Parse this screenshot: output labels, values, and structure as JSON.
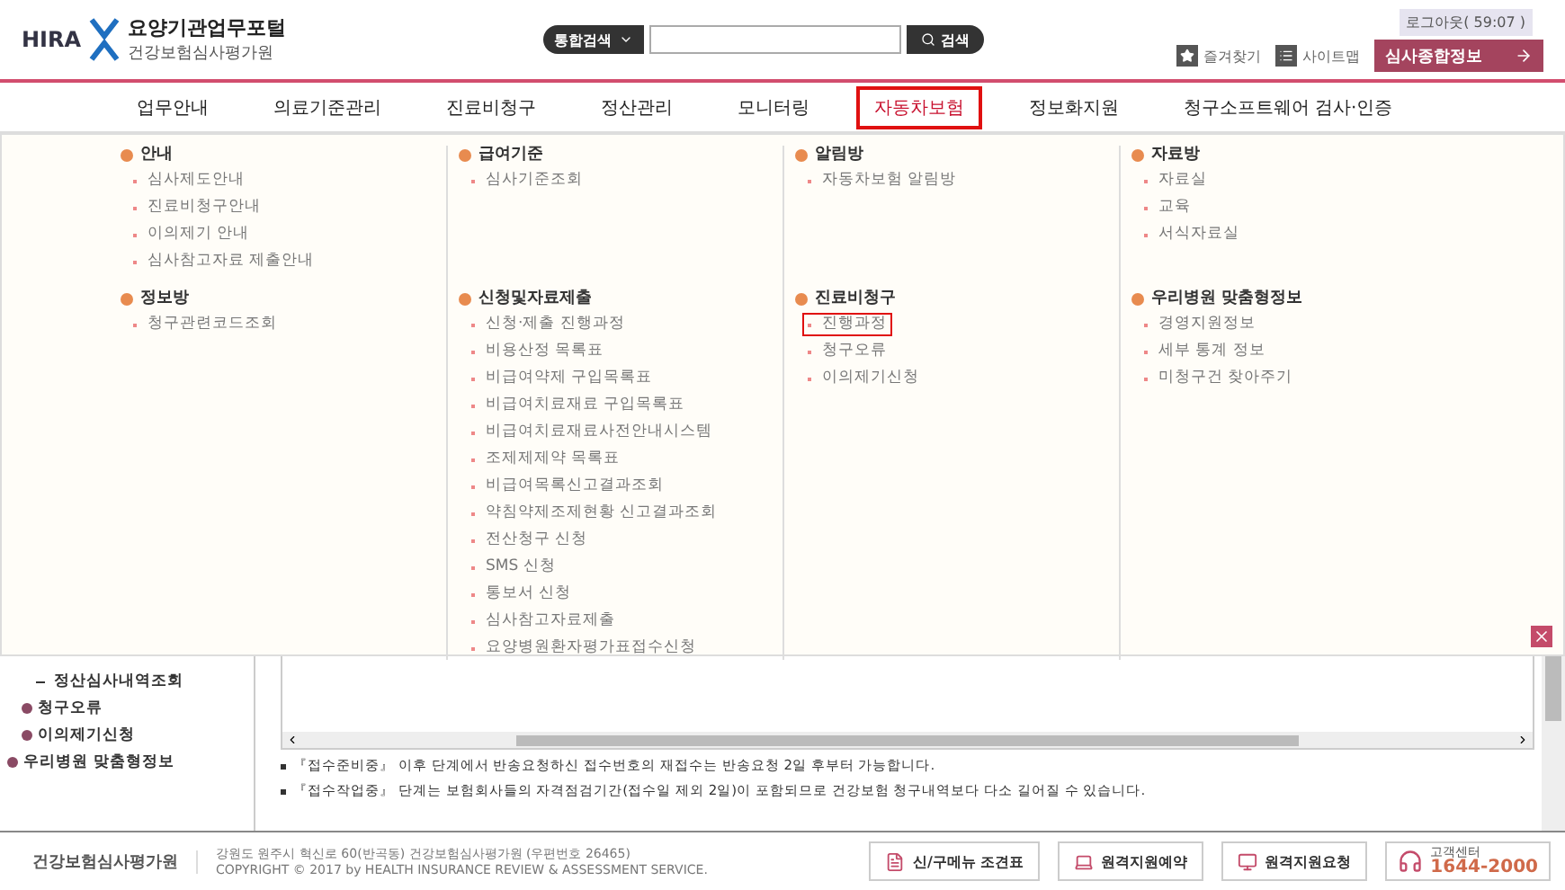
{
  "header": {
    "logo_brand": "HIRA",
    "logo_title": "요양기관업무포털",
    "logo_subtitle": "건강보험심사평가원",
    "search_scope": "통합검색",
    "search_button": "검색",
    "logout": "로그아웃( 59:07 )",
    "favorites": "즐겨찾기",
    "sitemap": "사이트맵",
    "review_info_button": "심사종합정보"
  },
  "nav": [
    {
      "label": "업무안내",
      "selected": false
    },
    {
      "label": "의료기준관리",
      "selected": false
    },
    {
      "label": "진료비청구",
      "selected": false
    },
    {
      "label": "정산관리",
      "selected": false
    },
    {
      "label": "모니터링",
      "selected": false
    },
    {
      "label": "자동차보험",
      "selected": true
    },
    {
      "label": "정보화지원",
      "selected": false
    },
    {
      "label": "청구소프트웨어 검사·인증",
      "selected": false
    }
  ],
  "mega_menu": {
    "columns": [
      {
        "groups": [
          {
            "title": "안내",
            "items": [
              {
                "label": "심사제도안내",
                "selected": false
              },
              {
                "label": "진료비청구안내",
                "selected": false
              },
              {
                "label": "이의제기 안내",
                "selected": false
              },
              {
                "label": "심사참고자료 제출안내",
                "selected": false
              }
            ]
          },
          {
            "title": "정보방",
            "items": [
              {
                "label": "청구관련코드조회",
                "selected": false
              }
            ]
          }
        ]
      },
      {
        "groups": [
          {
            "title": "급여기준",
            "items": [
              {
                "label": "심사기준조회",
                "selected": false
              }
            ]
          },
          {
            "title": "신청및자료제출",
            "items": [
              {
                "label": "신청·제출 진행과정",
                "selected": false
              },
              {
                "label": "비용산정 목록표",
                "selected": false
              },
              {
                "label": "비급여약제 구입목록표",
                "selected": false
              },
              {
                "label": "비급여치료재료 구입목록표",
                "selected": false
              },
              {
                "label": "비급여치료재료사전안내시스템",
                "selected": false
              },
              {
                "label": "조제제제약 목록표",
                "selected": false
              },
              {
                "label": "비급여목록신고결과조회",
                "selected": false
              },
              {
                "label": "약침약제조제현황 신고결과조회",
                "selected": false
              },
              {
                "label": "전산청구 신청",
                "selected": false
              },
              {
                "label": "SMS 신청",
                "selected": false
              },
              {
                "label": "통보서 신청",
                "selected": false
              },
              {
                "label": "심사참고자료제출",
                "selected": false
              },
              {
                "label": "요양병원환자평가표접수신청",
                "selected": false
              }
            ]
          }
        ]
      },
      {
        "groups": [
          {
            "title": "알림방",
            "items": [
              {
                "label": "자동차보험 알림방",
                "selected": false
              }
            ]
          },
          {
            "title": "진료비청구",
            "items": [
              {
                "label": "진행과정",
                "selected": true
              },
              {
                "label": "청구오류",
                "selected": false
              },
              {
                "label": "이의제기신청",
                "selected": false
              }
            ]
          }
        ]
      },
      {
        "groups": [
          {
            "title": "자료방",
            "items": [
              {
                "label": "자료실",
                "selected": false
              },
              {
                "label": "교육",
                "selected": false
              },
              {
                "label": "서식자료실",
                "selected": false
              }
            ]
          },
          {
            "title": "우리병원 맞춤형정보",
            "items": [
              {
                "label": "경영지원정보",
                "selected": false
              },
              {
                "label": "세부 통계 정보",
                "selected": false
              },
              {
                "label": "미청구건 찾아주기",
                "selected": false
              }
            ]
          }
        ]
      }
    ]
  },
  "sidebar": {
    "items": [
      {
        "kind": "sub",
        "label": "정산심사내역조회"
      },
      {
        "kind": "group",
        "label": "청구오류"
      },
      {
        "kind": "group",
        "label": "이의제기신청"
      },
      {
        "kind": "top",
        "label": "우리병원 맞춤형정보"
      }
    ]
  },
  "notes": [
    "『접수준비중』 이후 단계에서 반송요청하신 접수번호의 재접수는 반송요청 2일 후부터 가능합니다.",
    "『접수작업중』 단계는 보험회사들의 자격점검기간(접수일 제외 2일)이 포함되므로 건강보험 청구내역보다 다소 길어질 수 있습니다."
  ],
  "footer": {
    "logo": "건강보험심사평가원",
    "address": "강원도 원주시 혁신로 60(반곡동) 건강보험심사평가원  (우편번호 26465)",
    "copyright": "COPYRIGHT © 2017 by HEALTH INSURANCE REVIEW & ASSESSMENT SERVICE.",
    "buttons": [
      "신/구메뉴 조견표",
      "원격지원예약",
      "원격지원요청"
    ],
    "call_center_label": "고객센터",
    "call_center_number": "1644-2000"
  }
}
